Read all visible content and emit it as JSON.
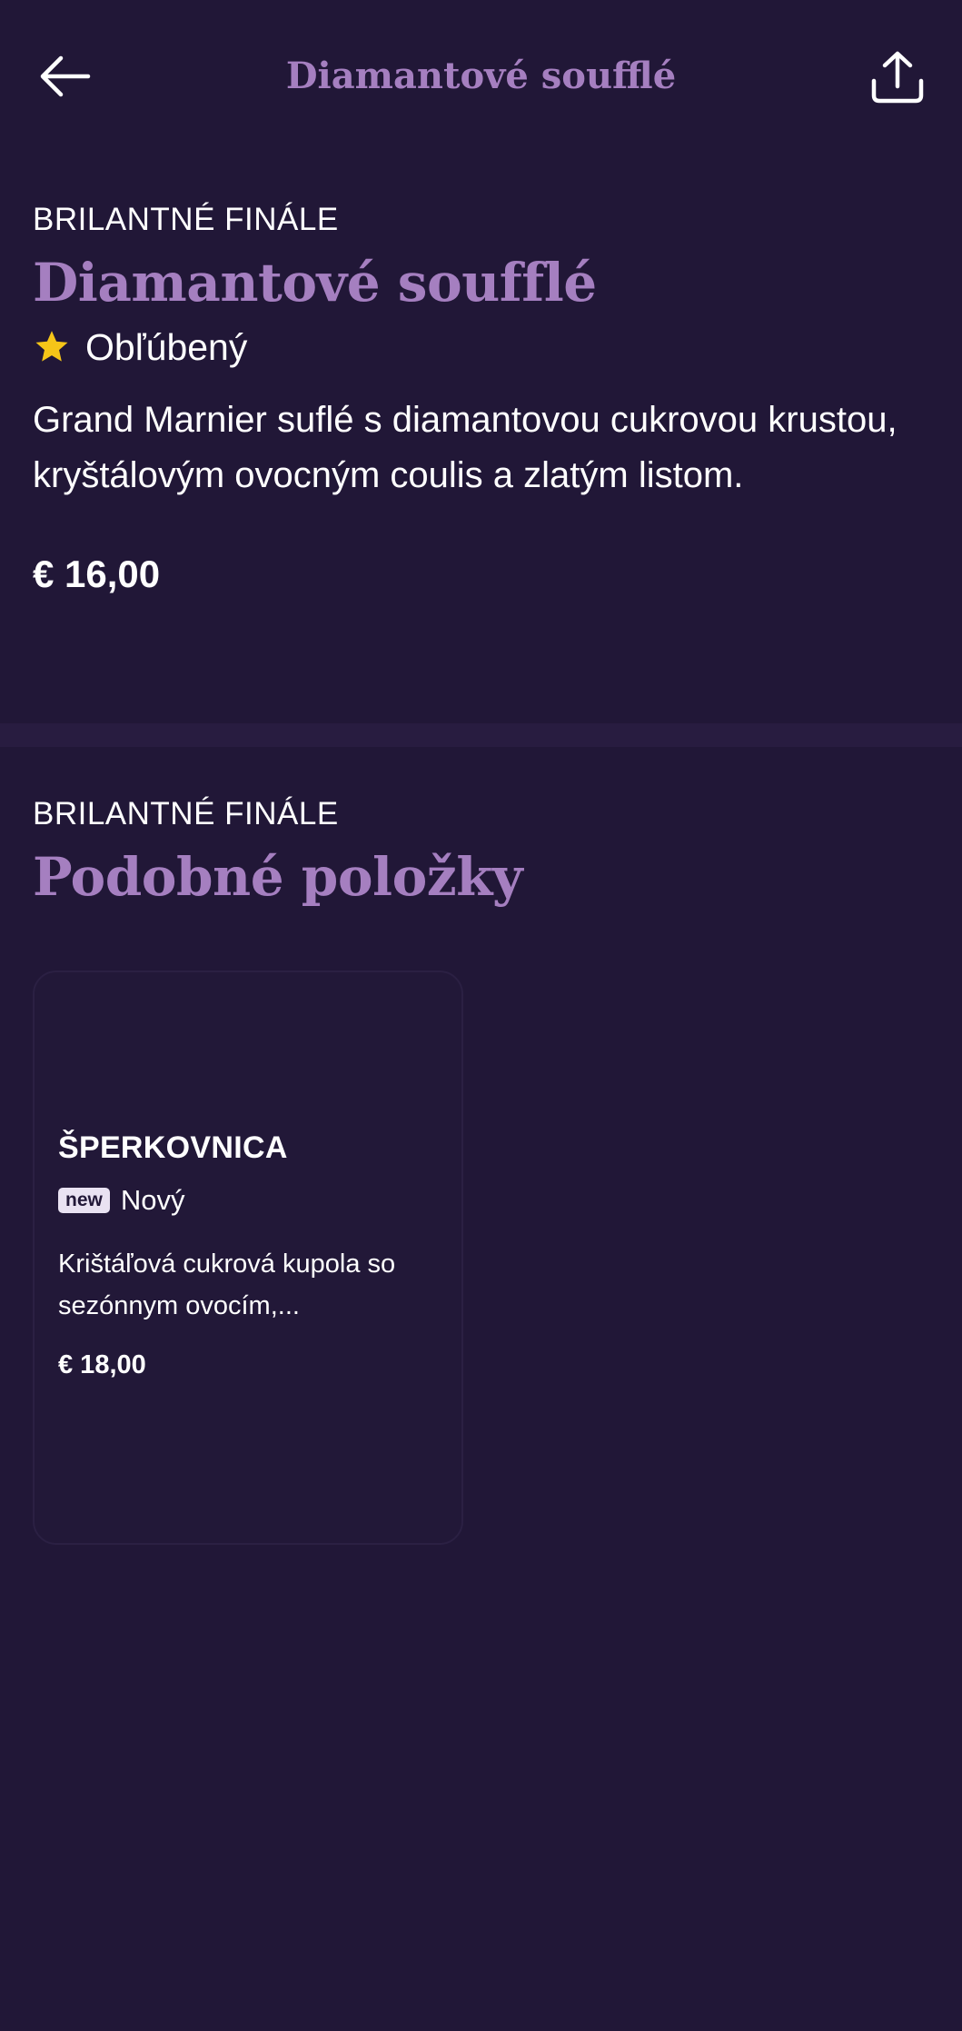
{
  "header": {
    "title": "Diamantové soufflé",
    "back_icon": "arrow-left-icon",
    "share_icon": "share-icon"
  },
  "item": {
    "category": "BRILANTNÉ FINÁLE",
    "title": "Diamantové soufflé",
    "favorite_label": "Obľúbený",
    "favorite_icon": "star-icon",
    "description": "Grand Marnier suflé s diamantovou cukrovou krustou, kryštálovým ovocným coulis a zlatým listom.",
    "price": "€ 16,00"
  },
  "similar": {
    "category": "BRILANTNÉ FINÁLE",
    "title": "Podobné položky",
    "items": [
      {
        "title": "ŠPERKOVNICA",
        "badge": "new",
        "badge_label": "Nový",
        "description": "Krištáľová cukrová kupola so sezónnym ovocím,...",
        "price": "€ 18,00"
      }
    ]
  },
  "colors": {
    "background": "#211737",
    "accent": "#a57fc0",
    "star": "#f5c518",
    "text": "#ffffff"
  }
}
